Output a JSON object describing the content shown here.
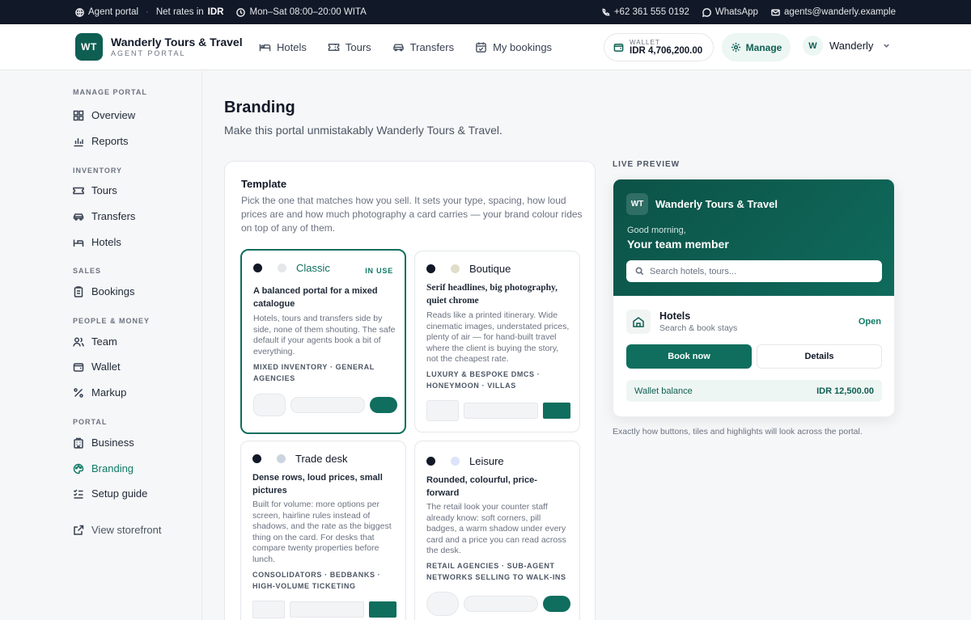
{
  "topbar": {
    "portal": "Agent portal",
    "rates_prefix": "Net rates in",
    "rates_currency": "IDR",
    "hours": "Mon–Sat 08:00–20:00 WITA",
    "phone": "+62 361 555 0192",
    "whatsapp": "WhatsApp",
    "email": "agents@wanderly.example"
  },
  "header": {
    "logo": "WT",
    "brand": "Wanderly Tours & Travel",
    "subtitle": "AGENT PORTAL",
    "nav": [
      "Hotels",
      "Tours",
      "Transfers",
      "My bookings"
    ],
    "wallet_label": "WALLET",
    "wallet_value": "IDR 4,706,200.00",
    "manage": "Manage",
    "user_initial": "W",
    "user_name": "Wanderly"
  },
  "sidebar": {
    "sections": [
      "MANAGE PORTAL",
      "INVENTORY",
      "SALES",
      "PEOPLE & MONEY",
      "PORTAL"
    ],
    "items": [
      "Overview",
      "Reports",
      "Tours",
      "Transfers",
      "Hotels",
      "Bookings",
      "Team",
      "Wallet",
      "Markup",
      "Business",
      "Branding",
      "Setup guide",
      "View storefront"
    ]
  },
  "page": {
    "title": "Branding",
    "subtitle": "Make this portal unmistakably Wanderly Tours & Travel."
  },
  "template": {
    "heading": "Template",
    "description": "Pick the one that matches how you sell. It sets your type, spacing, how loud prices are and how much photography a card carries — your brand colour rides on top of any of them.",
    "in_use": "IN USE",
    "options": [
      {
        "name": "Classic",
        "tagline": "A balanced portal for a mixed catalogue",
        "text": "Hotels, tours and transfers side by side, none of them shouting. The safe default if your agents book a bit of everything.",
        "fit": "MIXED INVENTORY · GENERAL AGENCIES"
      },
      {
        "name": "Boutique",
        "tagline": "Serif headlines, big photography, quiet chrome",
        "text": "Reads like a printed itinerary. Wide cinematic images, understated prices, plenty of air — for hand-built travel where the client is buying the story, not the cheapest rate.",
        "fit": "LUXURY & BESPOKE DMCS · HONEYMOON · VILLAS"
      },
      {
        "name": "Trade desk",
        "tagline": "Dense rows, loud prices, small pictures",
        "text": "Built for volume: more options per screen, hairline rules instead of shadows, and the rate as the biggest thing on the card. For desks that compare twenty properties before lunch.",
        "fit": "CONSOLIDATORS · BEDBANKS · HIGH-VOLUME TICKETING"
      },
      {
        "name": "Leisure",
        "tagline": "Rounded, colourful, price-forward",
        "text": "The retail look your counter staff already know: soft corners, pill badges, a warm shadow under every card and a price you can read across the desk.",
        "fit": "RETAIL AGENCIES · SUB-AGENT NETWORKS SELLING TO WALK-INS"
      }
    ]
  },
  "preview": {
    "label": "LIVE PREVIEW",
    "logo": "WT",
    "brand": "Wanderly Tours & Travel",
    "greeting": "Good morning,",
    "name": "Your team member",
    "search_placeholder": "Search hotels, tours...",
    "tile_title": "Hotels",
    "tile_sub": "Search & book stays",
    "tile_status": "Open",
    "primary": "Book now",
    "secondary": "Details",
    "wallet_label": "Wallet balance",
    "wallet_value": "IDR 12,500.00",
    "caption": "Exactly how buttons, tiles and highlights will look across the portal."
  },
  "colors": {
    "brand": "#0f5e52",
    "accent": "#0f7a66",
    "topbar": "#111827"
  }
}
